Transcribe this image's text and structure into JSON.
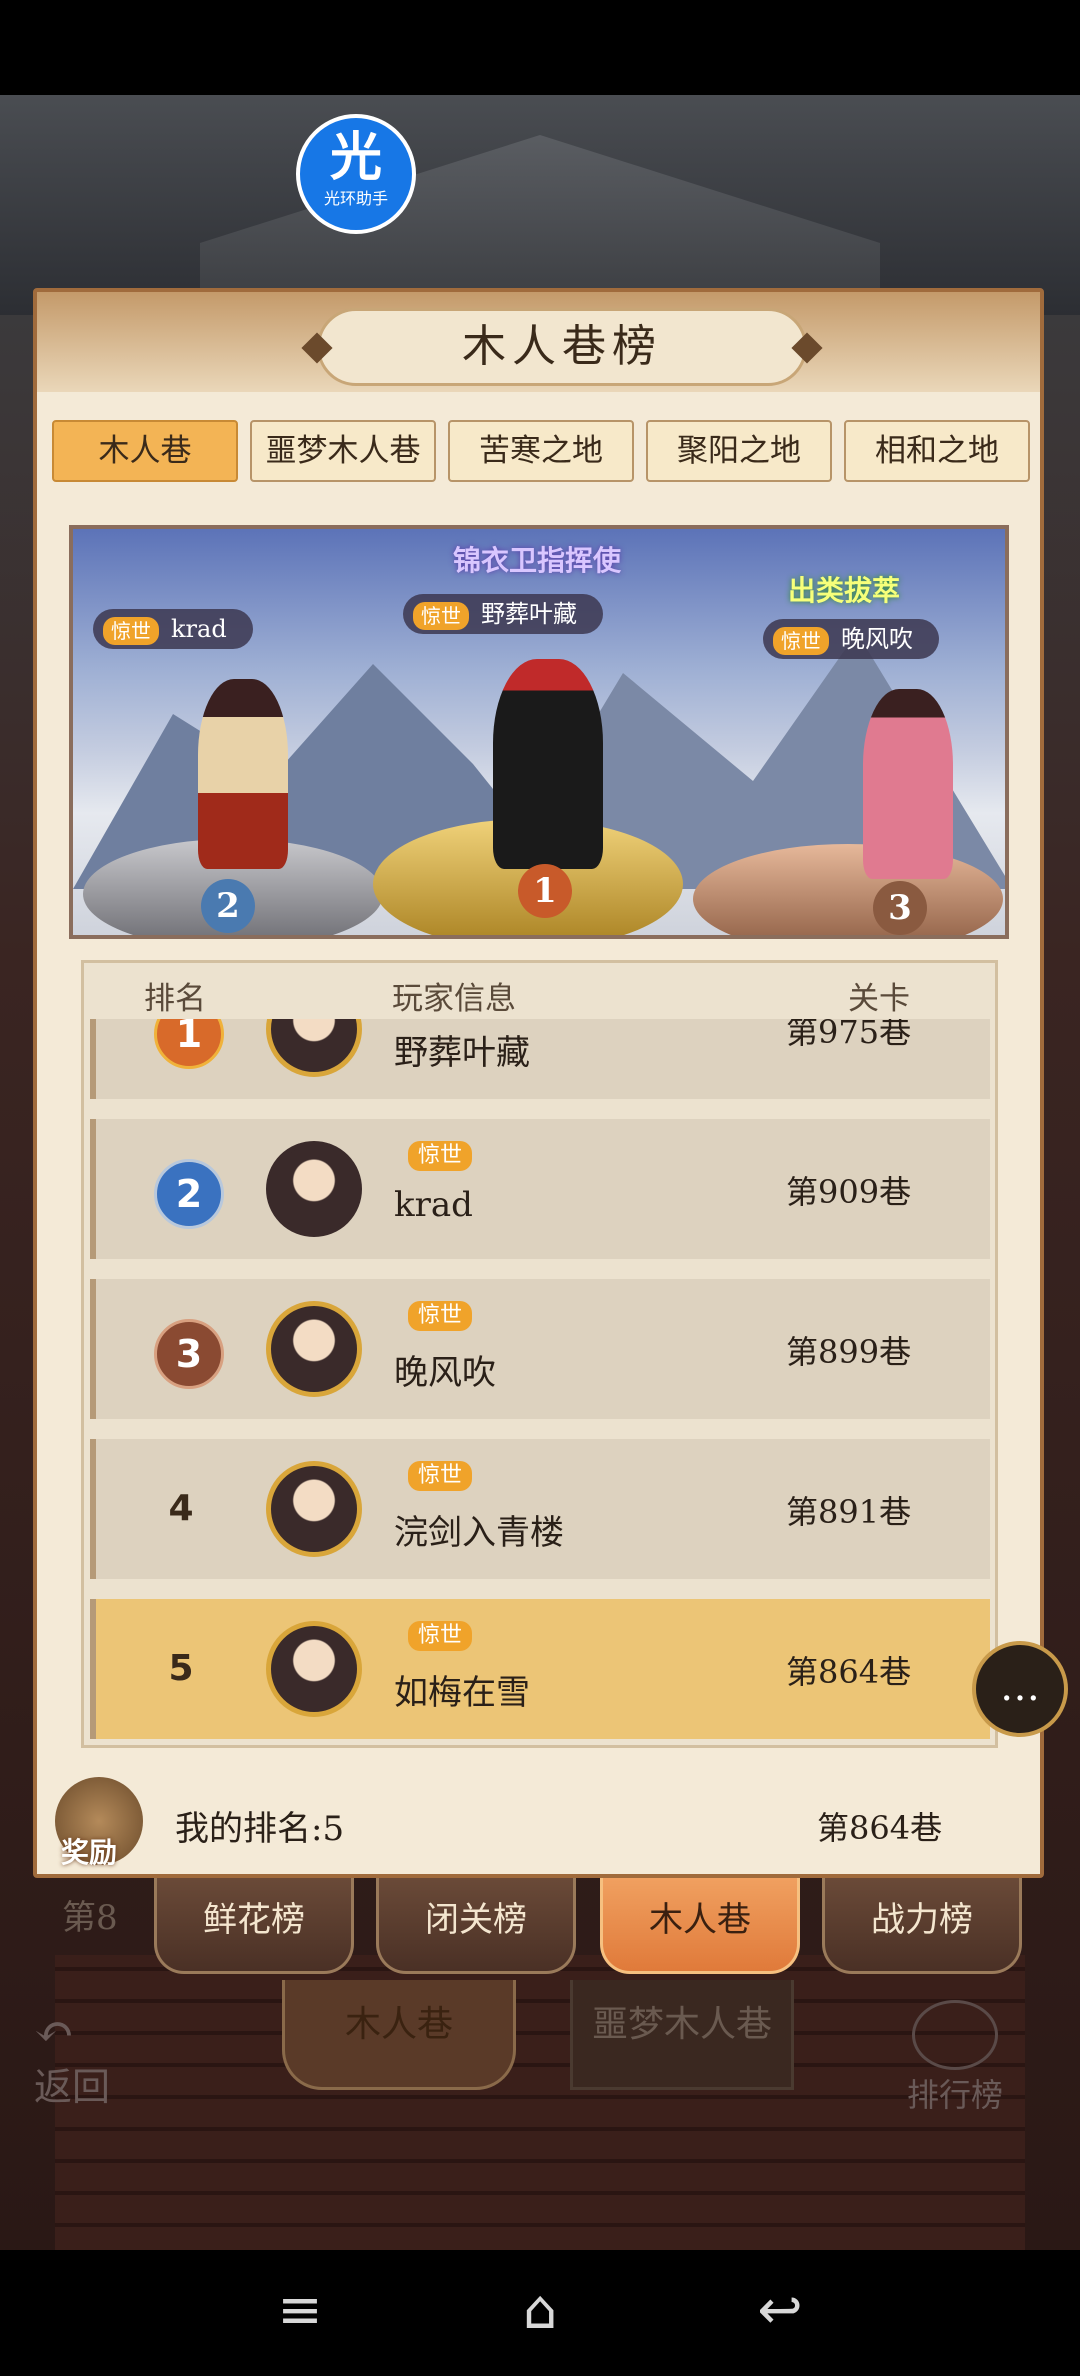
{
  "overlay_badge": {
    "glyph": "光",
    "label": "光环助手"
  },
  "panel": {
    "title": "木人巷榜"
  },
  "tabs": [
    "木人巷",
    "噩梦木人巷",
    "苦寒之地",
    "聚阳之地",
    "相和之地"
  ],
  "podium": {
    "titles": {
      "first": "锦衣卫指挥使",
      "third": "出类拔萃"
    },
    "tag": "惊世",
    "first": {
      "medal": "1",
      "name": "野葬叶藏"
    },
    "second": {
      "medal": "2",
      "name": "krad"
    },
    "third": {
      "medal": "3",
      "name": "晚风吹"
    }
  },
  "list_header": {
    "rank": "排名",
    "info": "玩家信息",
    "level": "关卡"
  },
  "rows": [
    {
      "rank": "1",
      "tag": "",
      "name": "野葬叶藏",
      "level": "第975巷"
    },
    {
      "rank": "2",
      "tag": "惊世",
      "name": "krad",
      "level": "第909巷"
    },
    {
      "rank": "3",
      "tag": "惊世",
      "name": "晚风吹",
      "level": "第899巷"
    },
    {
      "rank": "4",
      "tag": "惊世",
      "name": "浣剑入青楼",
      "level": "第891巷"
    },
    {
      "rank": "5",
      "tag": "惊世",
      "name": "如梅在雪",
      "level": "第864巷"
    }
  ],
  "my_rank": {
    "reward_label": "奖励",
    "label": "我的排名:5",
    "level": "第864巷"
  },
  "chat_icon": "…",
  "bottom_tabs": [
    "鲜花榜",
    "闭关榜",
    "木人巷",
    "战力榜"
  ],
  "behind_text": "第8",
  "sub_tabs": [
    "木人巷",
    "噩梦木人巷"
  ],
  "back_label": "返回",
  "rank_button_label": "排行榜",
  "system_nav": {
    "menu": "≡",
    "home": "⌂",
    "back": "↩"
  }
}
